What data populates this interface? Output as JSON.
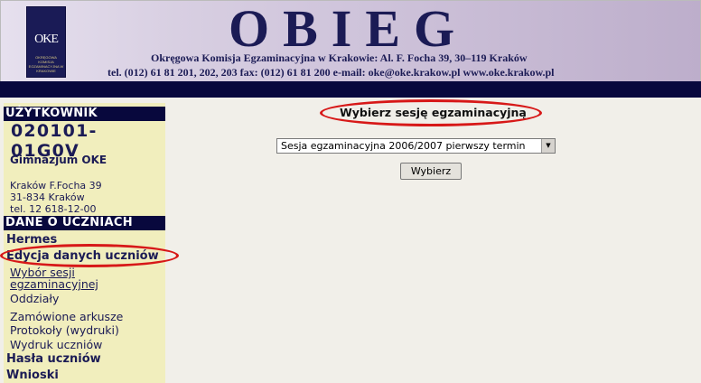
{
  "header": {
    "logo_mark": "OKE",
    "logo_sub": "OKRĘGOWA KOMISJA EGZAMINACYJNA W KRAKOWIE",
    "title": "OBIEG",
    "address_line1": "Okręgowa Komisja Egzaminacyjna w Krakowie:  Al. F. Focha 39, 30–119 Kraków",
    "address_line2": "tel. (012) 61 81 201, 202, 203  fax: (012) 61 81 200  e-mail: oke@oke.krakow.pl   www.oke.krakow.pl"
  },
  "sidebar": {
    "user_header": "UŻYTKOWNIK",
    "user_id": "020101-01G0V",
    "school_name": "Gimnazjum OKE",
    "address": [
      "Kraków F.Focha 39",
      "31-834 Kraków",
      "tel. 12 618-12-00"
    ],
    "students_header": "DANE O UCZNIACH",
    "hermes": "Hermes",
    "edit_students": "Edycja danych uczniów",
    "sub_items": {
      "session_choice_1": "Wybór sesji",
      "session_choice_2": "egzaminacyjnej",
      "classes": "Oddziały",
      "ordered_sheets": "Zamówione arkusze",
      "protocols": "Protokoły (wydruki)",
      "students_printout": "Wydruk uczniów"
    },
    "passwords": "Hasła uczniów",
    "requests": "Wnioski"
  },
  "main": {
    "heading": "Wybierz sesję egzaminacyjną",
    "session_selected": "Sesja egzaminacyjna 2006/2007 pierwszy termin",
    "choose_button": "Wybierz"
  },
  "colors": {
    "navy": "#08083d",
    "sidebar_bg": "#f1eebd",
    "highlight_red": "#d71818"
  }
}
